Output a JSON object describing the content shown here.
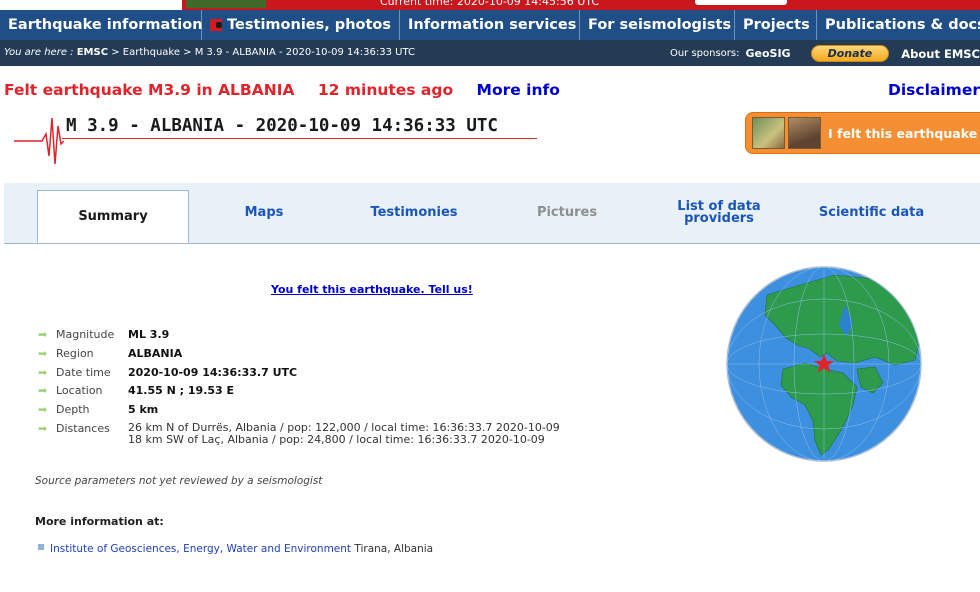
{
  "top": {
    "current_time": "Current time: 2020-10-09 14:45:56 UTC"
  },
  "nav": [
    {
      "label": "Earthquake information"
    },
    {
      "label": "Testimonies, photos",
      "flag": true
    },
    {
      "label": "Information services"
    },
    {
      "label": "For seismologists"
    },
    {
      "label": "Projects"
    },
    {
      "label": "Publications & docs"
    }
  ],
  "breadcrumb": {
    "prefix": "You are here :",
    "emsc": "EMSC",
    "trail": " > Earthquake > M 3.9 - ALBANIA - 2020-10-09 14:36:33 UTC",
    "sponsors": "Our sponsors:",
    "sponsor_name": "GeoSIG",
    "donate": "Donate",
    "about": "About EMSC"
  },
  "felt": {
    "headline": "Felt earthquake M3.9 in ALBANIA",
    "ago": "12 minutes ago",
    "more": "More info",
    "disclaimer": "Disclaimer"
  },
  "event_title": "M 3.9 - ALBANIA - 2020-10-09 14:36:33 UTC",
  "felt_button": "I felt this earthquake",
  "tabs": [
    "Summary",
    "Maps",
    "Testimonies",
    "Pictures",
    "List of data providers",
    "Scientific data"
  ],
  "tell_us": "You felt this earthquake. Tell us!",
  "params": [
    {
      "label": "Magnitude",
      "value": "ML 3.9"
    },
    {
      "label": "Region",
      "value": "ALBANIA"
    },
    {
      "label": "Date time",
      "value": "2020-10-09 14:36:33.7 UTC"
    },
    {
      "label": "Location",
      "value": "41.55 N ; 19.53 E"
    },
    {
      "label": "Depth",
      "value": "5 km"
    }
  ],
  "distances": {
    "label": "Distances",
    "line1": "26 km N of Durrës, Albania / pop: 122,000 / local time: 16:36:33.7 2020-10-09",
    "line2": "18 km SW of Laç, Albania / pop: 24,800 / local time: 16:36:33.7 2020-10-09"
  },
  "source_note": "Source parameters not yet reviewed by a seismologist",
  "more_info_title": "More information at:",
  "institute": {
    "link": "Institute of Geosciences, Energy, Water and Environment",
    "location": " Tirana, Albania"
  },
  "colors": {
    "nav": "#1f4f86",
    "breadbar": "#243b55",
    "headline": "#e0242a",
    "link": "#0000cc",
    "felt_button": "#f68f33",
    "ocean": "#3d8fe0",
    "land": "#2e9a4c"
  }
}
